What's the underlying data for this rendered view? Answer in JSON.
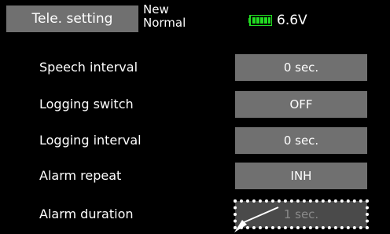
{
  "header": {
    "title": "Tele. setting",
    "model_line1": "New",
    "model_line2": "Normal",
    "battery_icon": "battery-full-icon",
    "battery_color": "#22dd22",
    "voltage": "6.6V"
  },
  "rows": [
    {
      "label": "Speech interval",
      "value": "0 sec."
    },
    {
      "label": "Logging switch",
      "value": "OFF"
    },
    {
      "label": "Logging interval",
      "value": "0 sec."
    },
    {
      "label": "Alarm repeat",
      "value": "INH"
    },
    {
      "label": "Alarm duration",
      "value": "1 sec."
    }
  ],
  "colors": {
    "background": "#000000",
    "button": "#707070",
    "text": "#ffffff"
  }
}
